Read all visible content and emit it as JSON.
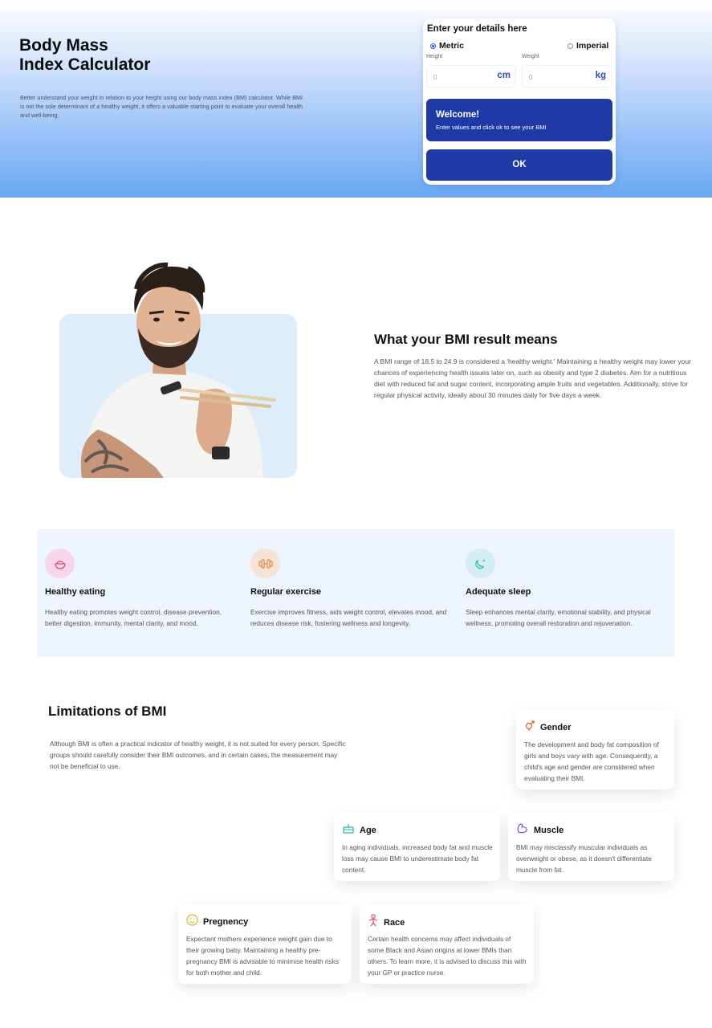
{
  "hero": {
    "title": "Body Mass\nIndex Calculator",
    "description": "Better understand your weight in relation to your height using our body mass index (BM) calculator. While BMI is not the sole determinant of a healthy weight, it offers a valuable starting point to evaluate your overall health and well-being."
  },
  "calculator": {
    "heading": "Enter your details here",
    "metric_label": "Metric",
    "imperial_label": "Imperial",
    "selected_unit": "Metric",
    "height_label": "Height",
    "weight_label": "Weight",
    "height_value": "0",
    "height_unit": "cm",
    "weight_value": "0",
    "weight_unit": "kg",
    "welcome_title": "Welcome!",
    "welcome_text": "Enter values and click ok to see your BMI",
    "ok_label": "OK",
    "accent_color": "#1f3aa6"
  },
  "result": {
    "title": "What your BMI result means",
    "text": "A BMI range of 18.5 to 24.9 is considered a 'healthy weight.' Maintaining a healthy weight may lower your chances of experiencing health issues later on, such as obesity and type 2 diabetes. Aim for a nutritious diet with reduced fat and sugar content, incorporating ample fruits and vegetables. Additionally, strive for regular physical activity, ideally about 30 minutes daily for five days a week."
  },
  "benefits": [
    {
      "icon": "food-bowl-icon",
      "title": "Healthy eating",
      "text": "Healthy eating promotes weight control, disease prevention, better digestion, immunity, mental clarity, and mood.",
      "color": "#e0457b",
      "bg": "#f7d6e8"
    },
    {
      "icon": "dumbbell-icon",
      "title": "Regular exercise",
      "text": "Exercise improves fitness, aids weight control, elevates mood, and reduces disease risk, fostering wellness and longevity.",
      "color": "#e08a3c",
      "bg": "#f6e3d6"
    },
    {
      "icon": "moon-icon",
      "title": "Adequate sleep",
      "text": "Sleep enhances mental clarity, emotional stability, and physical wellness, promoting overall restoration and rejuvenation.",
      "color": "#2bb3b3",
      "bg": "#d3eef2"
    }
  ],
  "limitations": {
    "title": "Limitations of BMI",
    "text": "Although BMI is often a practical indicator of healthy weight, it is not suited for every person. Specific groups should carefully consider their BMI outcomes, and in certain cases, the measurement may not be beneficial to use.",
    "cards": [
      {
        "icon": "gender-icon",
        "title": "Gender",
        "text": "The development and body fat composition of girls and boys vary with age. Consequently, a child's age and gender are considered when evaluating their BMI.",
        "color": "#e0612c"
      },
      {
        "icon": "cake-icon",
        "title": "Age",
        "text": "In aging individuals, increased body fat and muscle loss may cause BMI to underestimate body fat content.",
        "color": "#2bb3b3"
      },
      {
        "icon": "muscle-icon",
        "title": "Muscle",
        "text": "BMI may misclassify muscular individuals as overweight or obese, as it doesn't differentiate muscle from fat.",
        "color": "#8a4fd6"
      },
      {
        "icon": "pregnancy-icon",
        "title": "Pregnency",
        "text": "Expectant mothers experience weight gain due to their growing baby. Maintaining a healthy pre-pregnancy BMI is advisable to minimise health risks for both mother and child.",
        "color": "#e0b41c"
      },
      {
        "icon": "person-icon",
        "title": "Race",
        "text": "Certain health concerns may affect individuals of some Black and Asian origins at lower BMIs than others. To learn more, it is advised to discuss this with your GP or practice nurse.",
        "color": "#e0457b"
      }
    ]
  }
}
